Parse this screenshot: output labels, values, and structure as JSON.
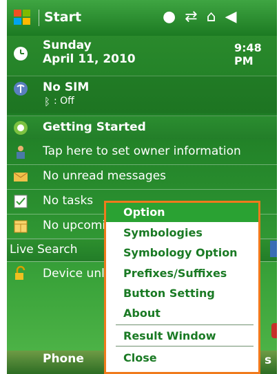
{
  "title_bar": {
    "start_label": "Start",
    "icons": [
      "globe-icon",
      "sync-arrows-icon",
      "connectivity-icon",
      "speaker-icon"
    ]
  },
  "date_row": {
    "day": "Sunday",
    "date": "April 11, 2010",
    "time": "9:48 PM"
  },
  "sim_row": {
    "title": "No SIM",
    "bluetooth": ": Off"
  },
  "getting_started": {
    "label": "Getting Started"
  },
  "owner": {
    "label": "Tap here to set owner information"
  },
  "messages": {
    "label": "No unread messages"
  },
  "tasks": {
    "label": "No tasks"
  },
  "upcoming": {
    "label": "No upcoming appointments"
  },
  "search": {
    "label": "Live Search"
  },
  "device": {
    "label": "Device unlocked"
  },
  "softkeys": {
    "left": "Phone",
    "right": "s"
  },
  "menu": {
    "items": [
      {
        "label": "Option",
        "selected": true
      },
      {
        "label": "Symbologies",
        "selected": false
      },
      {
        "label": "Symbology Option",
        "selected": false
      },
      {
        "label": "Prefixes/Suffixes",
        "selected": false
      },
      {
        "label": "Button Setting",
        "selected": false
      },
      {
        "label": "About",
        "selected": false
      },
      {
        "label": "Result Window",
        "selected": false
      },
      {
        "label": "Close",
        "selected": false
      }
    ]
  },
  "colors": {
    "menu_border": "#f07a1c",
    "menu_selected": "#2aa233",
    "menu_text": "#1a7a24",
    "background": "#1f7d25"
  }
}
